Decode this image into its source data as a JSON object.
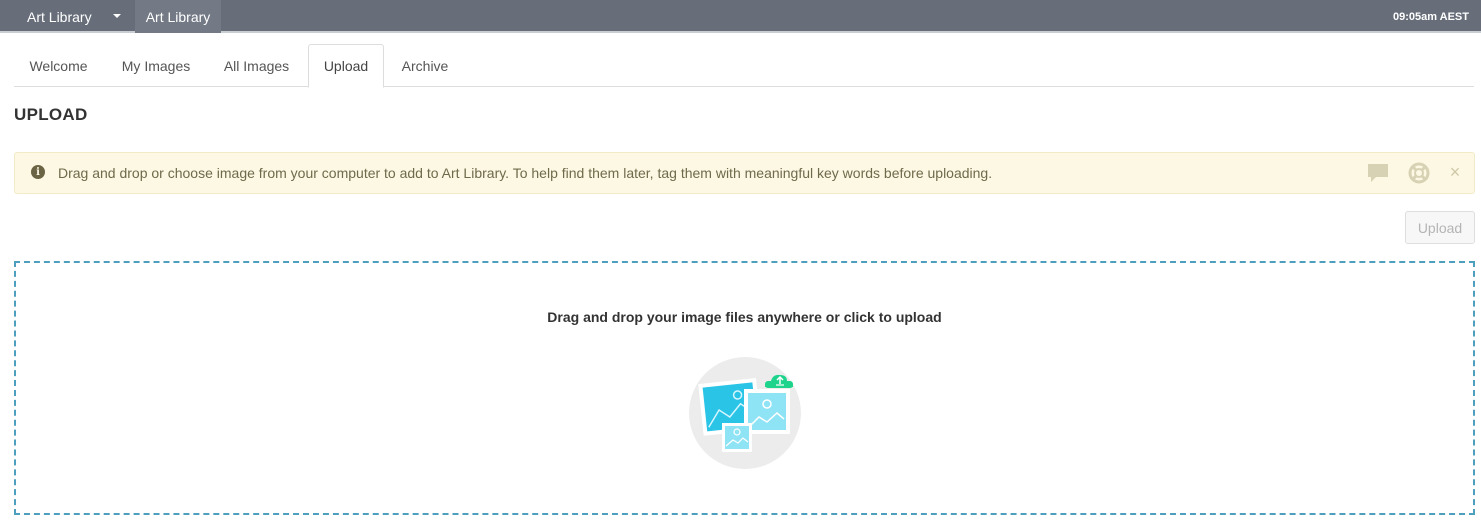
{
  "topbar": {
    "app_switcher_label": "Art Library",
    "breadcrumb": "Art Library",
    "clock": "09:05am AEST"
  },
  "tabs": [
    {
      "label": "Welcome",
      "active": false
    },
    {
      "label": "My Images",
      "active": false
    },
    {
      "label": "All Images",
      "active": false
    },
    {
      "label": "Upload",
      "active": true
    },
    {
      "label": "Archive",
      "active": false
    }
  ],
  "page": {
    "title": "UPLOAD"
  },
  "banner": {
    "message": "Drag and drop or choose image from your computer to add to Art Library. To help find them later, tag them with meaningful key words before uploading.",
    "info_icon": "info-icon",
    "chat_icon": "chat-bubble-icon",
    "help_icon": "lifebuoy-icon",
    "close_icon": "close-icon",
    "close_glyph": "×"
  },
  "actions": {
    "upload_label": "Upload",
    "upload_disabled": true
  },
  "dropzone": {
    "text": "Drag and drop your image files anywhere or click to upload",
    "illustration_icon": "image-upload-illustration"
  },
  "colors": {
    "topbar": "#676e7a",
    "banner_bg": "#fcf8e3",
    "dropzone_border": "#4e9fbe",
    "illustration_cyan": "#29c4e6",
    "cloud_green": "#1ed48c"
  }
}
